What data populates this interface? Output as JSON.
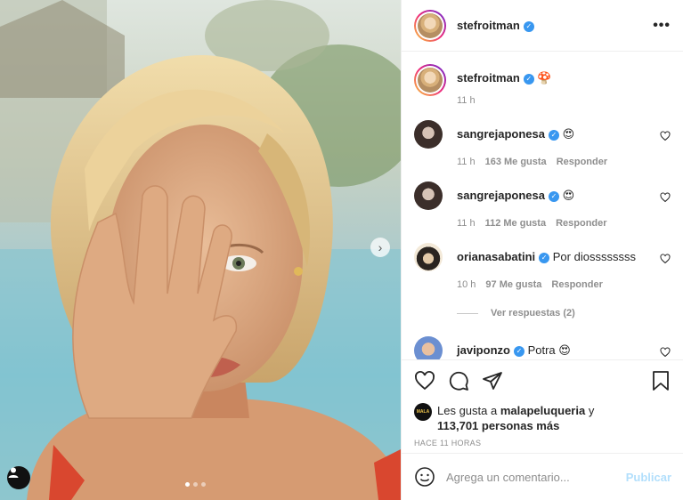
{
  "post": {
    "author": "stefroitman",
    "more_icon": "more-horizontal-icon",
    "photo": {
      "carousel_dots": 3,
      "active_dot": 1
    }
  },
  "caption": {
    "username": "stefroitman",
    "emoji": "🍄",
    "time": "11 h"
  },
  "comments": [
    {
      "username": "sangrejaponesa",
      "text": "😍",
      "time": "11 h",
      "likes": "163 Me gusta",
      "reply": "Responder"
    },
    {
      "username": "sangrejaponesa",
      "text": "😍",
      "time": "11 h",
      "likes": "112 Me gusta",
      "reply": "Responder"
    },
    {
      "username": "orianasabatini",
      "text": "Por diossssssss",
      "time": "10 h",
      "likes": "97 Me gusta",
      "reply": "Responder",
      "view_replies": "Ver respuestas (2)"
    },
    {
      "username": "javiponzo",
      "text": "Potra 😍"
    }
  ],
  "actions": {
    "like_icon": "heart-icon",
    "comment_icon": "comment-icon",
    "share_icon": "send-icon",
    "save_icon": "bookmark-icon"
  },
  "likes": {
    "prefix": "Les gusta a",
    "user": "malapeluqueria",
    "joiner": "y",
    "count": "113,701 personas más"
  },
  "timestamp": "HACE 11 HORAS",
  "composer": {
    "placeholder": "Agrega un comentario...",
    "publish": "Publicar",
    "emoji_icon": "smiley-icon"
  },
  "colors": {
    "verified": "#3897f0",
    "publish_disabled": "#b2dffc",
    "meta_gray": "#8e8e8e"
  }
}
